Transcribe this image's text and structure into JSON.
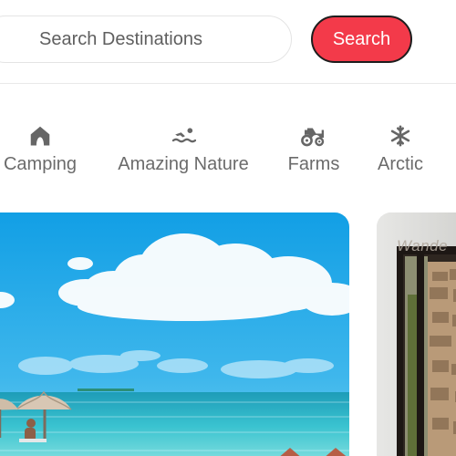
{
  "header": {
    "search": {
      "placeholder": "Search Destinations",
      "button_label": "Search"
    }
  },
  "categories": [
    {
      "label": "Camping",
      "icon": "tent-icon"
    },
    {
      "label": "Amazing Nature",
      "icon": "swimming-icon"
    },
    {
      "label": "Farms",
      "icon": "tractor-icon"
    },
    {
      "label": "Arctic",
      "icon": "snowflake-icon"
    }
  ],
  "listings": [
    {
      "image": "beach-umbrella-photo"
    },
    {
      "image": "stone-house-photo",
      "overlay_text": "Wande"
    }
  ],
  "colors": {
    "accent": "#f33a4a",
    "text_muted": "#6b6b6b",
    "border": "#e4e4e4"
  }
}
